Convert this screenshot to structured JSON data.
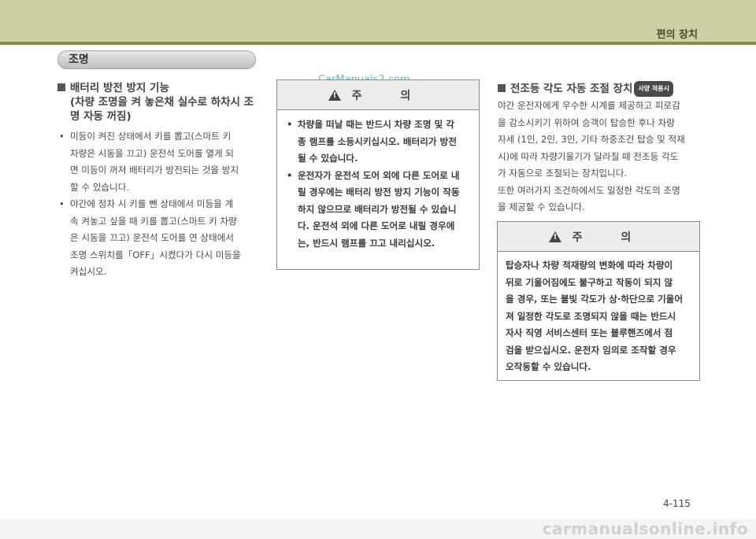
{
  "header": {
    "title": "편의 장치"
  },
  "section": {
    "label": "조명"
  },
  "left": {
    "heading1": "배터리 방전 방지 기능",
    "heading2": "(차량 조명을 켜 놓은채 실수로 하차시 조",
    "heading3": "명 자동 꺼짐)",
    "b1": [
      "미등이 켜진 상태에서 키를 뽑고(스마트 키",
      "차량은 시동을 끄고) 운전석 도어를 열게 되",
      "면 미등이 꺼져 배터리가 방전되는 것을 방지",
      "할 수 있습니다."
    ],
    "b2": [
      "야간에 정차 시 키를 뺀 상태에서 미등을 계",
      "속 켜놓고 싶을 때 키를 뽑고(스마트 키 차량",
      "은 시동을 끄고) 운전석 도어를 연 상태에서",
      "조명 스위치를「OFF」시켰다가 다시 미등을",
      "켜십시오."
    ]
  },
  "middle": {
    "caution_title": "주 의",
    "b1": [
      "차량을 떠날 때는 반드시 차량 조명 및 각",
      "종 램프를 소등시키십시오. 배터리가 방전",
      "될 수 있습니다."
    ],
    "b2": [
      "운전자가 운전석 도어 외에 다른 도어로 내",
      "릴 경우에는 배터리 방전 방지 기능이 작동",
      "하지 않으므로 배터리가 방전될 수 있습니",
      "다. 운전석 외에 다른 도어로 내릴 경우에",
      "는, 반드시 램프를 끄고 내리십시오."
    ]
  },
  "right": {
    "heading": "전조등 각도 자동 조절 장치",
    "badge": "사양 적용시",
    "p1": [
      "야간 운전자에게 우수한 시계를 제공하고 피로감",
      "을 감소시키기 위하여 승객이 탑승한 후나 차량",
      "자세 (1인, 2인, 3인, 기타 하중조건 탑승 및 적재",
      "시)에 따라 차량기울기가 달라질 때 전조등 각도",
      "가 자동으로 조절되는 장치입니다."
    ],
    "p2": [
      "또한 여러가지 조건하에서도 일정한 각도의 조명",
      "을 제공할 수 있습니다."
    ],
    "caution_title": "주 의",
    "caution": [
      "탑승자나 차량 적재량의 변화에 따라 차량이",
      "뒤로 기울어짐에도 불구하고 작동이 되지 않",
      "을 경우, 또는 불빛 각도가 상·하단으로 기울어",
      "져 일정한 각도로 조명되지 않을 때는 반드시",
      "자사 직영 서비스센터 또는 블루핸즈에서 점",
      "검을 받으십시오. 운전자 임의로 조작할 경우",
      "오작동할 수 있습니다."
    ]
  },
  "watermark": "CarManuals2.com",
  "page_number": "4-115",
  "site_watermark": "carmanualsonline.info"
}
